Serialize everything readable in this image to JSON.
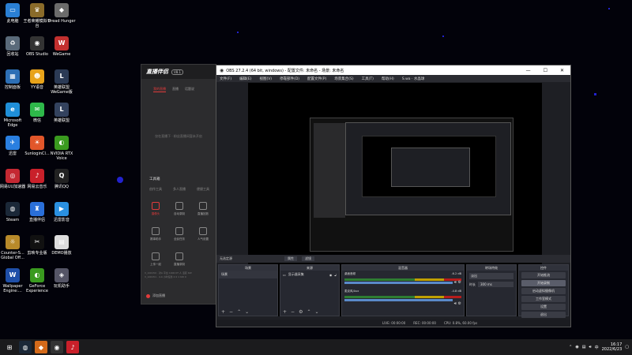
{
  "desktop": {
    "icons": [
      {
        "label": "此电脑",
        "glyph": "▭",
        "color": "#2a7fd4"
      },
      {
        "label": "王者荣耀模拟平台",
        "glyph": "♛",
        "color": "#8a6b2a"
      },
      {
        "label": "Dread Hunger",
        "glyph": "◆",
        "color": "#6b6b6b"
      },
      {
        "label": "回收站",
        "glyph": "♻",
        "color": "#5a6a7a"
      },
      {
        "label": "OBS Studio",
        "glyph": "◉",
        "color": "#333"
      },
      {
        "label": "WeGame",
        "glyph": "W",
        "color": "#c2302f"
      },
      {
        "label": "控制面板",
        "glyph": "▦",
        "color": "#2d6fb5"
      },
      {
        "label": "YY语音",
        "glyph": "☻",
        "color": "#e8a31a"
      },
      {
        "label": "英雄联盟WeGame版",
        "glyph": "L",
        "color": "#2b3a55"
      },
      {
        "label": "Microsoft Edge",
        "glyph": "e",
        "color": "#1f8fd8"
      },
      {
        "label": "微信",
        "glyph": "✉",
        "color": "#2eb84a"
      },
      {
        "label": "英雄联盟",
        "glyph": "L",
        "color": "#33425e"
      },
      {
        "label": "迅雷",
        "glyph": "✈",
        "color": "#2a7fe0"
      },
      {
        "label": "SunloginCl...",
        "glyph": "☀",
        "color": "#e2562a"
      },
      {
        "label": "NVIDIA RTX Voice",
        "glyph": "◐",
        "color": "#3a9a1f"
      },
      {
        "label": "网易UU加速器",
        "glyph": "◎",
        "color": "#c42832"
      },
      {
        "label": "网易云音乐",
        "glyph": "♪",
        "color": "#c9202a"
      },
      {
        "label": "腾讯QQ",
        "glyph": "Q",
        "color": "#222"
      },
      {
        "label": "Steam",
        "glyph": "◍",
        "color": "#1b2838"
      },
      {
        "label": "直播伴侣",
        "glyph": "♜",
        "color": "#2a6fd8"
      },
      {
        "label": "迅雷影音",
        "glyph": "▶",
        "color": "#2a90e0"
      },
      {
        "label": "Counter-S... Global Off...",
        "glyph": "☼",
        "color": "#b88a2a"
      },
      {
        "label": "剪映专业版",
        "glyph": "✂",
        "color": "#111"
      },
      {
        "label": "DEMO播放",
        "glyph": "▤",
        "color": "#ddd"
      },
      {
        "label": "Wallpaper Engine:...",
        "glyph": "W",
        "color": "#1f4fa8"
      },
      {
        "label": "GeForce Experience",
        "glyph": "◐",
        "color": "#3a9a1f"
      },
      {
        "label": "玩机助手",
        "glyph": "◈",
        "color": "#556"
      }
    ]
  },
  "zhibo": {
    "logo": "直播伴侣",
    "version": "V8.1",
    "tabs": [
      "我的直播",
      "直播",
      "话题说"
    ],
    "empty_text": "仅在直播下 · 粉丝直播间暂未开启",
    "tools_title": "工具箱",
    "tools_tabs": [
      "创作工具",
      "多人直播",
      "便捷工具"
    ],
    "tools": [
      {
        "label": "摄像头",
        "red": true
      },
      {
        "label": "自动录制",
        "red": false
      },
      {
        "label": "直播回放",
        "red": false
      },
      {
        "label": "赛事助手",
        "red": false
      },
      {
        "label": "全民任务",
        "red": false
      },
      {
        "label": "人气设置",
        "red": false
      },
      {
        "label": "上传一起",
        "red": false
      },
      {
        "label": "直播录制",
        "red": false
      }
    ],
    "list_lines": [
      "V_100150 · 对A 平台 1000 KT 人 活跃 KW",
      "V_100151 · 4.0 小时任务 2 0 1 KW 0"
    ],
    "add_label": "添加直播"
  },
  "obs": {
    "title": "OBS 27.2.4 (64 bit, windows) - 配置文件: 未命名 - 场景: 未命名",
    "menu": [
      "文件(F)",
      "编辑(E)",
      "视图(V)",
      "停靠部件(D)",
      "配置文件(P)",
      "场景集合(S)",
      "工具(T)",
      "帮助(H)",
      "S.wa · 水晶球"
    ],
    "source_bar": {
      "label": "无选定源",
      "props": "属性",
      "filters": "滤镜"
    },
    "docks": {
      "scenes": {
        "title": "场景",
        "item": "场景"
      },
      "sources": {
        "title": "来源",
        "item": "显示器采集"
      },
      "mixer": {
        "title": "混音器",
        "ch1": "桌面音频",
        "ch1_db": "-6.2 dB",
        "ch2": "麦克风/Aux",
        "ch2_db": "-4.8 dB"
      },
      "transitions": {
        "title": "转场特效",
        "type": "淡出",
        "duration_label": "时长",
        "duration": "300 ms"
      },
      "controls": {
        "title": "控件",
        "buttons": [
          "开始推流",
          "开始录制",
          "启动虚拟摄像机",
          "工作室模式",
          "设置",
          "退出"
        ]
      }
    },
    "status": {
      "live": "LIVE: 00:00:00",
      "rec": "REC: 00:00:00",
      "cpu": "CPU: 0.8%, 60.00 fps"
    }
  },
  "taskbar": {
    "time": "16:17",
    "date": "2022/6/23",
    "lang": "中",
    "apps": [
      {
        "name": "start",
        "glyph": "⊞",
        "color": "#1b1b1d"
      },
      {
        "name": "steam",
        "glyph": "◍",
        "color": "#1b2838"
      },
      {
        "name": "game",
        "glyph": "◆",
        "color": "#d46a1a"
      },
      {
        "name": "obs",
        "glyph": "◉",
        "color": "#333"
      },
      {
        "name": "netease",
        "glyph": "♪",
        "color": "#c9202a"
      }
    ]
  },
  "colors": {
    "accent": "#e23b3b",
    "obs_bg": "#1e1f24"
  }
}
